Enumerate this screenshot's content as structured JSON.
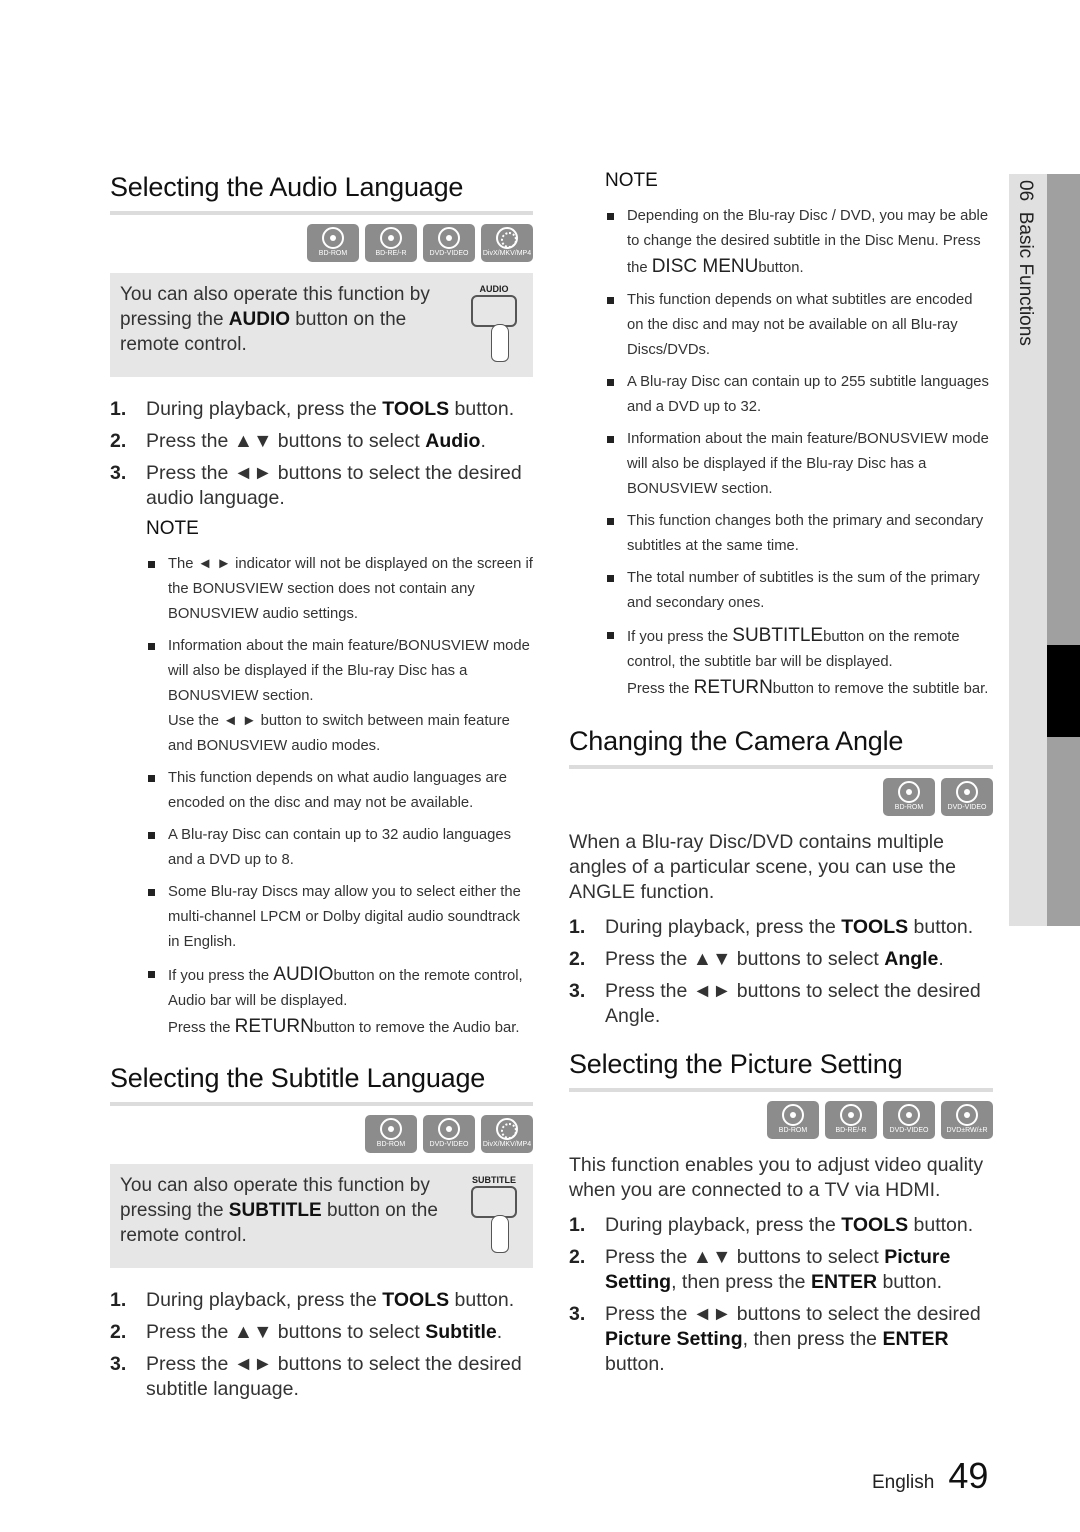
{
  "side_tab": {
    "chapter": "06",
    "title": "Basic Functions"
  },
  "footer": {
    "language": "English",
    "page_number": "49"
  },
  "audio_section": {
    "title": "Selecting the Audio Language",
    "discs": [
      "BD-ROM",
      "BD-RE/-R",
      "DVD-VIDEO",
      "DivX/MKV/MP4"
    ],
    "tip": {
      "pre": "You can also operate this function by pressing the ",
      "bold": "AUDIO",
      "post": " button on the remote control.",
      "remote_label": "AUDIO"
    },
    "steps": [
      {
        "num": "1.",
        "pre": "During playback, press the ",
        "bold": "TOOLS",
        "post": " button."
      },
      {
        "num": "2.",
        "pre": "Press the ▲▼ buttons to select ",
        "bold": "Audio",
        "post": "."
      },
      {
        "num": "3.",
        "pre": "Press the ◄► buttons to select the desired audio language.",
        "bold": "",
        "post": ""
      }
    ],
    "note_heading": "NOTE",
    "notes": [
      {
        "text": "The ◄ ► indicator will not be displayed on the screen if the BONUSVIEW section does not contain any BONUSVIEW audio settings."
      },
      {
        "text": "Information about the main feature/BONUSVIEW mode will also be displayed if the Blu-ray Disc has a BONUSVIEW section.",
        "extra": "Use the ◄ ► button to switch between main feature and BONUSVIEW audio modes."
      },
      {
        "text": "This function depends on what audio languages are encoded on the disc and may not be available."
      },
      {
        "text": "A Blu-ray Disc can contain up to 32 audio languages and a DVD up to 8."
      },
      {
        "text": "Some Blu-ray Discs may allow you to select either the multi-channel LPCM or Dolby digital audio soundtrack in English."
      },
      {
        "pre": "If you press the ",
        "big": "AUDIO",
        "post": "button on the remote control, Audio bar will be displayed.",
        "extra_pre": "Press the ",
        "extra_big": "RETURN",
        "extra_post": "button to remove the Audio bar."
      }
    ]
  },
  "subtitle_section": {
    "title": "Selecting the Subtitle Language",
    "discs": [
      "BD-ROM",
      "DVD-VIDEO",
      "DivX/MKV/MP4"
    ],
    "tip": {
      "pre": "You can also operate this function by pressing the ",
      "bold": "SUBTITLE",
      "post": " button on the remote control.",
      "remote_label": "SUBTITLE"
    },
    "steps": [
      {
        "num": "1.",
        "pre": "During playback, press the ",
        "bold": "TOOLS",
        "post": " button."
      },
      {
        "num": "2.",
        "pre": "Press the ▲▼ buttons to select ",
        "bold": "Subtitle",
        "post": "."
      },
      {
        "num": "3.",
        "pre": "Press the ◄► buttons to select the desired subtitle language.",
        "bold": "",
        "post": ""
      }
    ],
    "note_heading": "NOTE",
    "notes": [
      {
        "pre": "Depending on the Blu-ray Disc / DVD, you may be able to change the desired subtitle in the Disc Menu. Press the ",
        "big": "DISC MENU",
        "post": "button."
      },
      {
        "text": "This function depends on what subtitles are encoded on the disc and may not be available on all Blu-ray Discs/DVDs."
      },
      {
        "text": "A Blu-ray Disc can contain up to 255 subtitle languages and a DVD up to 32."
      },
      {
        "text": "Information about the main feature/BONUSVIEW mode will also be displayed if the Blu-ray Disc has a BONUSVIEW section."
      },
      {
        "text": "This function changes both the primary and secondary subtitles at the same time."
      },
      {
        "text": "The total number of subtitles is the sum of the primary and secondary ones."
      },
      {
        "pre": "If you press the ",
        "big": "SUBTITLE",
        "post": "button on the remote control, the subtitle bar will be displayed.",
        "extra_pre": "Press the ",
        "extra_big": "RETURN",
        "extra_post": "button to remove the subtitle bar."
      }
    ]
  },
  "angle_section": {
    "title": "Changing the Camera Angle",
    "discs": [
      "BD-ROM",
      "DVD-VIDEO"
    ],
    "intro": "When a Blu-ray Disc/DVD contains multiple angles of a particular scene, you can use the ANGLE function.",
    "steps": [
      {
        "num": "1.",
        "pre": "During playback, press the ",
        "bold": "TOOLS",
        "post": " button."
      },
      {
        "num": "2.",
        "pre": "Press the ▲▼ buttons to select ",
        "bold": "Angle",
        "post": "."
      },
      {
        "num": "3.",
        "pre": "Press the ◄► buttons to select the desired Angle.",
        "bold": "",
        "post": ""
      }
    ]
  },
  "picture_section": {
    "title": "Selecting the Picture Setting",
    "discs": [
      "BD-ROM",
      "BD-RE/-R",
      "DVD-VIDEO",
      "DVD±RW/±R"
    ],
    "intro": "This function enables you to adjust video quality when you are connected to a TV via HDMI.",
    "steps": [
      {
        "num": "1.",
        "pre": "During playback, press the ",
        "bold": "TOOLS",
        "post": " button."
      },
      {
        "num": "2.",
        "pre": "Press the ▲▼ buttons to select ",
        "bold": "Picture Setting",
        "post": ", then press the ",
        "bold2": "ENTER",
        "post2": " button."
      },
      {
        "num": "3.",
        "pre": "Press the ◄► buttons to select the desired ",
        "bold": "Picture Setting",
        "post": ", then press the ",
        "bold2": "ENTER",
        "post2": " button."
      }
    ]
  }
}
